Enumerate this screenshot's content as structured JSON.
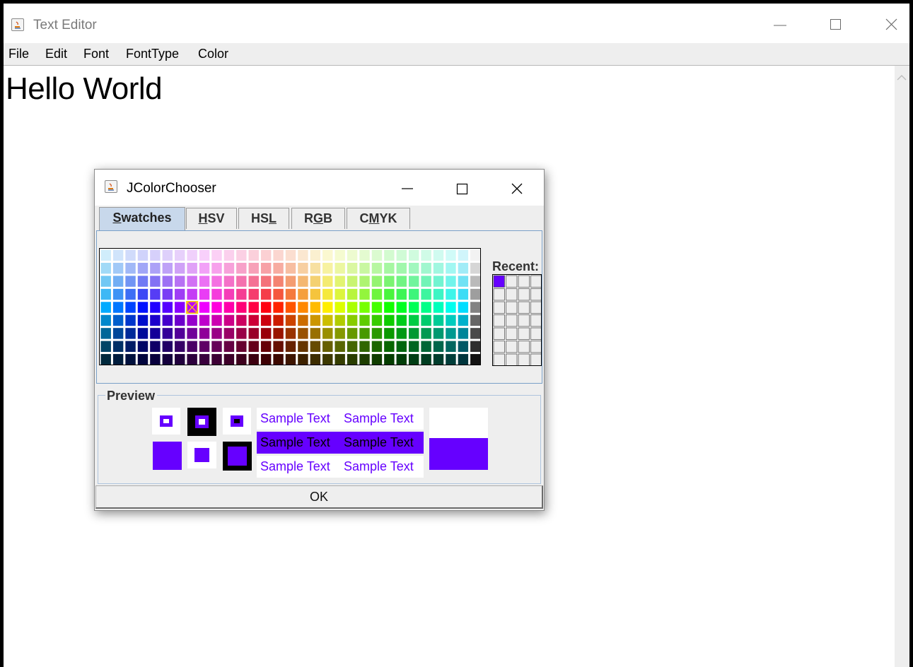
{
  "editor": {
    "title": "Text Editor",
    "menus": [
      "File",
      "Edit",
      "Font",
      "FontType",
      "Color"
    ],
    "content": "Hello World"
  },
  "dialog": {
    "title": "JColorChooser",
    "tabs": [
      {
        "label": "Swatches",
        "mnemonic": "S",
        "active": true
      },
      {
        "label": "HSV",
        "mnemonic": "H",
        "active": false
      },
      {
        "label": "HSL",
        "mnemonic": "L",
        "active": false
      },
      {
        "label": "RGB",
        "mnemonic": "G",
        "active": false
      },
      {
        "label": "CMYK",
        "mnemonic": "M",
        "active": false
      }
    ],
    "recent_label": "Recent:",
    "preview_label": "Preview",
    "sample_text": "Sample Text",
    "ok_label": "OK",
    "selected_color": "#6600ff"
  },
  "colors": {
    "accent": "#6600ff",
    "tab_active": "#c8d8eb",
    "dialog_bg": "#eeeeee"
  },
  "icons": [
    "java-icon",
    "minimize-icon",
    "maximize-icon",
    "close-icon",
    "scroll-up-arrow-icon"
  ]
}
